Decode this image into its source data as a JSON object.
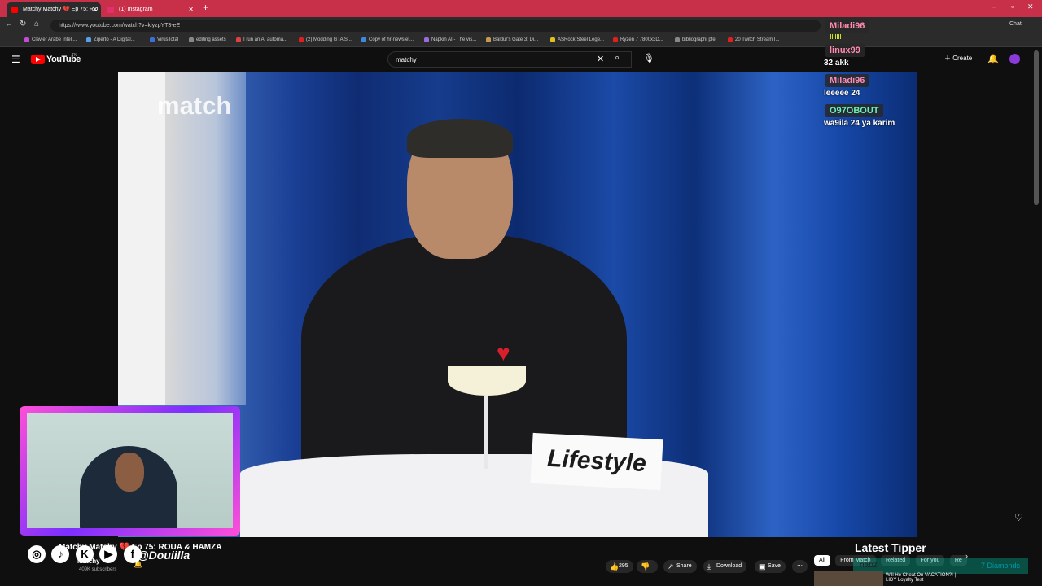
{
  "browser": {
    "tabs": [
      {
        "title": "Matchy Matchy 💔 Ep 75: RO"
      },
      {
        "title": "(1) Instagram"
      }
    ],
    "new_tab": "+",
    "url": "https://www.youtube.com/watch?v=klyzpYT3-eE",
    "bookmarks": [
      "Clavier Arabe Intell...",
      "Ziperto - A Digital...",
      "VirusTotal",
      "editing assets",
      "I run an AI automa...",
      "(2) Modding GTA S...",
      "Copy of hr-newslet...",
      "Napkin AI - The vis...",
      "Baldur's Gate 3: Di...",
      "ASRock Steel Lege...",
      "Ryzen 7 7800x3D...",
      "bibliographi pfe",
      "20 Twitch Stream I..."
    ],
    "chat_label": "Chat"
  },
  "youtube": {
    "logo_text": "YouTube",
    "logo_suffix": "TN",
    "search_value": "matchy",
    "create_label": "Create",
    "video_title": "Matchy Matchy 💔 Ep 75: ROUA & HAMZA",
    "channel": "Matchy",
    "subscribers": "409K subscribers",
    "likes": "295",
    "share_label": "Share",
    "download_label": "Download",
    "save_label": "Save",
    "chips": [
      "All",
      "From Match",
      "Related",
      "For you",
      "Re"
    ],
    "rec_title": "Will He Cheat On VACATION?! |",
    "rec_sub": "LIDY Loyalty Test"
  },
  "video_frame": {
    "brand_text": "match",
    "sign_text": "Lifestyle"
  },
  "overlay": {
    "chat": [
      {
        "user": "Miladi96",
        "color": "#ff8ab0",
        "message": ""
      },
      {
        "user": "linux99",
        "color": "#ff8ab0",
        "message": "32 akk"
      },
      {
        "user": "Miladi96",
        "color": "#ff8ab0",
        "message": "leeeee 24"
      },
      {
        "user": "O97OBOUT",
        "color": "#69f0ae",
        "message": "wa9ila 24 ya karim"
      }
    ],
    "social_handle": "@Douiilla",
    "latest_tipper_label": "Latest Tipper",
    "latest_tipper_name": "nabz",
    "diamonds": "7 Diamonds"
  },
  "colors": {
    "accent": "#c8304a",
    "youtube_red": "#ff0000",
    "cam_border": "#ff4fd8"
  }
}
